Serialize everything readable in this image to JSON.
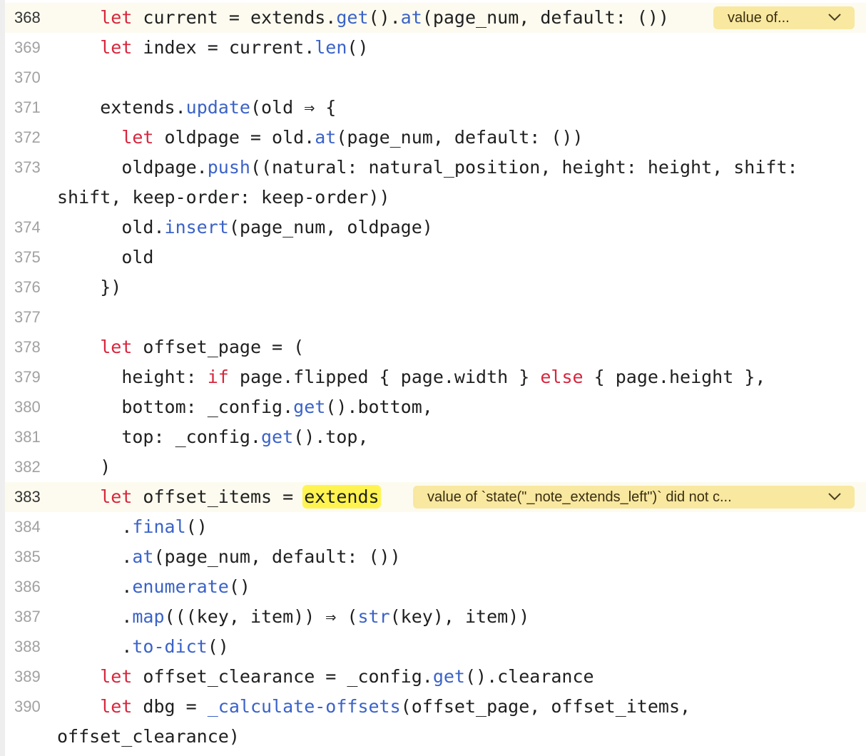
{
  "gutter": {
    "line_numbers": [
      "368",
      "369",
      "370",
      "371",
      "372",
      "373",
      "374",
      "375",
      "376",
      "377",
      "378",
      "379",
      "380",
      "381",
      "382",
      "383",
      "384",
      "385",
      "386",
      "387",
      "388",
      "389",
      "390"
    ]
  },
  "code": {
    "l368": {
      "indent": "    ",
      "t1": "let",
      "t2": " current = extends.",
      "t3": "get",
      "t4": "().",
      "t5": "at",
      "t6": "(page_num, default: ())"
    },
    "l369": {
      "indent": "    ",
      "t1": "let",
      "t2": " index = current.",
      "t3": "len",
      "t4": "()"
    },
    "l371": {
      "indent": "    ",
      "t1": "extends.",
      "t2": "update",
      "t3": "(old ⇒ {"
    },
    "l372": {
      "indent": "      ",
      "t1": "let",
      "t2": " oldpage = old.",
      "t3": "at",
      "t4": "(page_num, default: ())"
    },
    "l373": {
      "indent": "      ",
      "t1": "oldpage.",
      "t2": "push",
      "t3": "((natural: natural_position, height: height, shift:"
    },
    "l373_wrap": "shift, keep-order: keep-order))",
    "l374": {
      "indent": "      ",
      "t1": "old.",
      "t2": "insert",
      "t3": "(page_num, oldpage)"
    },
    "l375": {
      "indent": "      ",
      "t1": "old"
    },
    "l376": {
      "indent": "    ",
      "t1": "})"
    },
    "l378": {
      "indent": "    ",
      "t1": "let",
      "t2": " offset_page = ("
    },
    "l379": {
      "indent": "      ",
      "t1": "height: ",
      "t2": "if",
      "t3": " page.flipped { page.width } ",
      "t4": "else",
      "t5": " { page.height },"
    },
    "l380": {
      "indent": "      ",
      "t1": "bottom: _config.",
      "t2": "get",
      "t3": "().bottom,"
    },
    "l381": {
      "indent": "      ",
      "t1": "top: _config.",
      "t2": "get",
      "t3": "().top,"
    },
    "l382": {
      "indent": "    ",
      "t1": ")"
    },
    "l383": {
      "indent": "    ",
      "t1": "let",
      "t2": " offset_items = ",
      "t3": "extends"
    },
    "l384": {
      "indent": "      ",
      "t1": ".",
      "t2": "final",
      "t3": "()"
    },
    "l385": {
      "indent": "      ",
      "t1": ".",
      "t2": "at",
      "t3": "(page_num, default: ())"
    },
    "l386": {
      "indent": "      ",
      "t1": ".",
      "t2": "enumerate",
      "t3": "()"
    },
    "l387": {
      "indent": "      ",
      "t1": ".",
      "t2": "map",
      "t3": "(((key, item)) ⇒ (",
      "t4": "str",
      "t5": "(key), item))"
    },
    "l388": {
      "indent": "      ",
      "t1": ".",
      "t2": "to-dict",
      "t3": "()"
    },
    "l389": {
      "indent": "    ",
      "t1": "let",
      "t2": " offset_clearance = _config.",
      "t3": "get",
      "t4": "().clearance"
    },
    "l390": {
      "indent": "    ",
      "t1": "let",
      "t2": " dbg = ",
      "t3": "_calculate-offsets",
      "t4": "(offset_page, offset_items,"
    },
    "l390_wrap": "offset_clearance)"
  },
  "hints": {
    "h368": "value of...",
    "h383": "value of `state(\"_note_extends_left\")` did not c..."
  },
  "icons": {
    "expand": "chevron-down-icon"
  },
  "colors": {
    "keyword": "#d7263d",
    "function": "#3a62c8",
    "hint_background": "#f8e8a0",
    "highlight": "#fff44f",
    "current_line": "#fdfbef"
  }
}
